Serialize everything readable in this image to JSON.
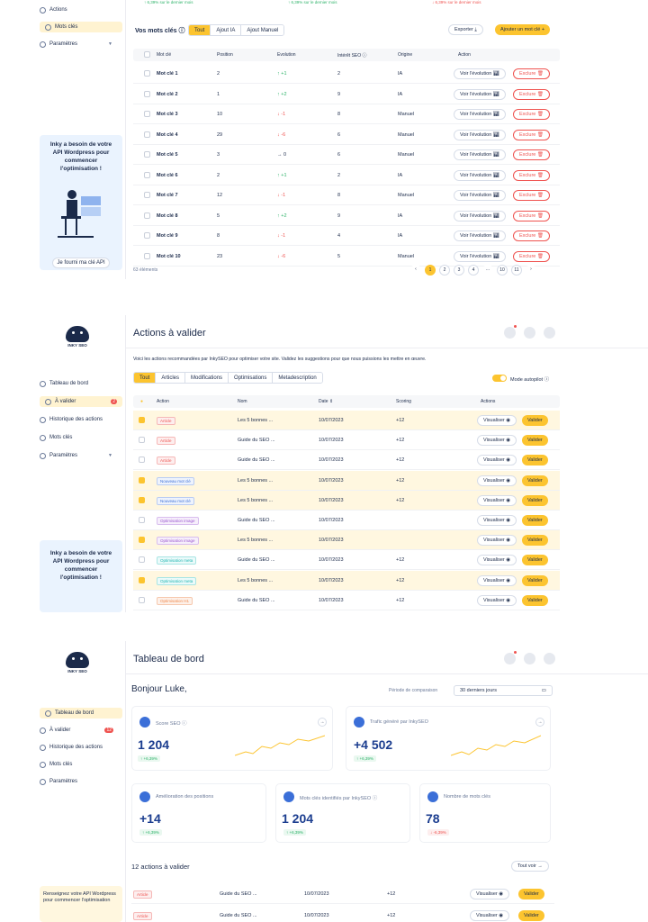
{
  "panel1": {
    "nav": [
      {
        "label": "Actions",
        "icon": "actions-icon"
      },
      {
        "label": "Mots clés",
        "icon": "key-icon"
      },
      {
        "label": "Paramètres",
        "icon": "gear-icon"
      }
    ],
    "kpi_notes": [
      {
        "text": "↑ 6,39% sur le dernier mois"
      },
      {
        "text": "↑ 6,39% sur le dernier mois"
      },
      {
        "text": "↓ 6,39% sur le dernier mois"
      }
    ],
    "section_title": "Vos mots clés",
    "tabs": [
      "Tout",
      "Ajout IA",
      "Ajout Manuel"
    ],
    "export_label": "Exporter",
    "add_label": "Ajouter un mot clé +",
    "columns": [
      "Mot clé",
      "Position",
      "Evolution",
      "Intérêt SEO",
      "Origine",
      "Action"
    ],
    "rows": [
      {
        "kw": "Mot clé 1",
        "pos": "2",
        "evo": "↑ +1",
        "dir": "up",
        "seo": "2",
        "origin": "IA"
      },
      {
        "kw": "Mot clé 2",
        "pos": "1",
        "evo": "↑ +2",
        "dir": "up",
        "seo": "9",
        "origin": "IA"
      },
      {
        "kw": "Mot clé 3",
        "pos": "10",
        "evo": "↓ -1",
        "dir": "down",
        "seo": "8",
        "origin": "Manuel"
      },
      {
        "kw": "Mot clé 4",
        "pos": "29",
        "evo": "↓ -6",
        "dir": "down",
        "seo": "6",
        "origin": "Manuel"
      },
      {
        "kw": "Mot clé 5",
        "pos": "3",
        "evo": "→ 0",
        "dir": "flat",
        "seo": "6",
        "origin": "Manuel"
      },
      {
        "kw": "Mot clé 6",
        "pos": "2",
        "evo": "↑ +1",
        "dir": "up",
        "seo": "2",
        "origin": "IA"
      },
      {
        "kw": "Mot clé 7",
        "pos": "12",
        "evo": "↓ -1",
        "dir": "down",
        "seo": "8",
        "origin": "Manuel"
      },
      {
        "kw": "Mot clé 8",
        "pos": "5",
        "evo": "↑ +2",
        "dir": "up",
        "seo": "9",
        "origin": "IA"
      },
      {
        "kw": "Mot clé 9",
        "pos": "8",
        "evo": "↓ -1",
        "dir": "down",
        "seo": "4",
        "origin": "IA"
      },
      {
        "kw": "Mot clé 10",
        "pos": "23",
        "evo": "↓ -6",
        "dir": "down",
        "seo": "5",
        "origin": "Manuel"
      }
    ],
    "view_label": "Voir l'évolution",
    "exclude_label": "Exclure",
    "count_label": "63 éléments",
    "pages": [
      "‹",
      "1",
      "2",
      "3",
      "4",
      "...",
      "10",
      "11",
      "›"
    ],
    "promo_text": "Inky a besoin de votre API Wordpress pour commencer l'optimisation !",
    "promo_button": "Je fourni ma clé API"
  },
  "panel2": {
    "brand": "INKY SEO",
    "title": "Actions à valider",
    "nav": [
      {
        "label": "Tableau de bord"
      },
      {
        "label": "À valider",
        "badge": "2"
      },
      {
        "label": "Historique des actions"
      },
      {
        "label": "Mots clés"
      },
      {
        "label": "Paramètres"
      }
    ],
    "intro": "Voici les actions recommandées par InkySEO pour optimiser votre site. Validez les suggestions pour que nous puissions les mettre en œuvre.",
    "tabs": [
      "Tout",
      "Articles",
      "Modifications",
      "Optimisations",
      "Metadescription"
    ],
    "autopilot_label": "Mode autopilot",
    "columns": [
      "Action",
      "Nom",
      "Date ⇕",
      "Scoring",
      "Actions"
    ],
    "rows": [
      {
        "tag": "Article",
        "type": "article",
        "name": "Les 5 bonnes ...",
        "date": "10/07/2023",
        "score": "+12",
        "checked": true
      },
      {
        "tag": "Article",
        "type": "article",
        "name": "Guide du SEO ...",
        "date": "10/07/2023",
        "score": "+12",
        "checked": false
      },
      {
        "tag": "Article",
        "type": "article",
        "name": "Guide du SEO ...",
        "date": "10/07/2023",
        "score": "+12",
        "checked": false
      },
      {
        "tag": "Nouveau mot clé",
        "type": "kw",
        "name": "Les 5 bonnes ...",
        "date": "10/07/2023",
        "score": "+12",
        "checked": true
      },
      {
        "tag": "Nouveau mot clé",
        "type": "kw",
        "name": "Les 5 bonnes ...",
        "date": "10/07/2023",
        "score": "+12",
        "checked": true
      },
      {
        "tag": "Optimisation image",
        "type": "img",
        "name": "Guide du SEO ...",
        "date": "10/07/2023",
        "score": "",
        "checked": false
      },
      {
        "tag": "Optimisation image",
        "type": "img",
        "name": "Les 5 bonnes ...",
        "date": "10/07/2023",
        "score": "",
        "checked": true
      },
      {
        "tag": "Optimisation meta",
        "type": "meta",
        "name": "Guide du SEO ...",
        "date": "10/07/2023",
        "score": "+12",
        "checked": false
      },
      {
        "tag": "Optimisation meta",
        "type": "meta",
        "name": "Les 5 bonnes ...",
        "date": "10/07/2023",
        "score": "+12",
        "checked": true
      },
      {
        "tag": "Optimisation H1",
        "type": "h1",
        "name": "Guide du SEO ...",
        "date": "10/07/2023",
        "score": "+12",
        "checked": false
      }
    ],
    "view_label": "Visualiser",
    "validate_label": "Valider",
    "promo_text": "Inky a besoin de votre API Wordpress pour commencer l'optimisation !"
  },
  "panel3": {
    "brand": "INKY SEO",
    "title": "Tableau de bord",
    "nav": [
      {
        "label": "Tableau de bord"
      },
      {
        "label": "À valider",
        "badge": "12"
      },
      {
        "label": "Historique des actions"
      },
      {
        "label": "Mots clés"
      },
      {
        "label": "Paramètres"
      }
    ],
    "greeting": "Bonjour Luke,",
    "period_label": "Période de comparaison",
    "period_value": "30 derniers jours",
    "cards": [
      {
        "label": "Score SEO",
        "value": "1 204",
        "pct": "↑ +6,39%",
        "dir": "up"
      },
      {
        "label": "Trafic généré par InkySEO",
        "value": "+4 502",
        "pct": "↑ +6,39%",
        "dir": "up"
      },
      {
        "label": "Amélioration des positions",
        "value": "+14",
        "pct": "↑ +6,39%",
        "dir": "up"
      },
      {
        "label": "Mots clés identifiés par InkySEO",
        "value": "1 204",
        "pct": "↑ +6,39%",
        "dir": "up"
      },
      {
        "label": "Nombre de mots clés",
        "value": "78",
        "pct": "↓ -6,39%",
        "dir": "down"
      }
    ],
    "actions_title": "12 actions à valider",
    "see_all": "Tout voir →",
    "rows": [
      {
        "tag": "Article",
        "name": "Guide du SEO ...",
        "date": "10/07/2023",
        "score": "+12"
      },
      {
        "tag": "Article",
        "name": "Guide du SEO ...",
        "date": "10/07/2023",
        "score": "+12"
      }
    ],
    "view_label": "Visualiser",
    "validate_label": "Valider",
    "promo_text": "Renseignez votre API Wordpress pour commencer l'optimisation"
  }
}
